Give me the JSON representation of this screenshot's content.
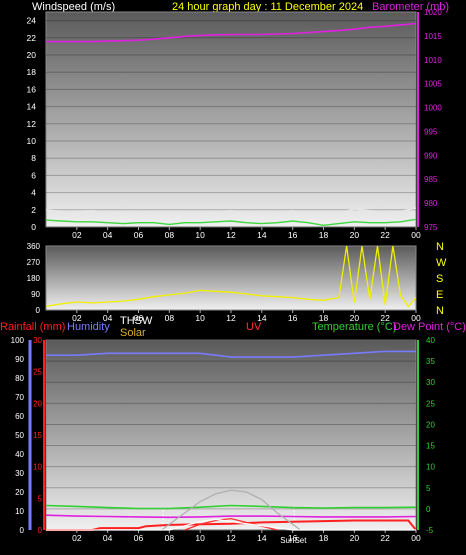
{
  "header": {
    "left_label": "Windspeed (m/s)",
    "title": "24 hour graph day : 11 December 2024",
    "right_label": "Barometer (mb)"
  },
  "lower_header": {
    "rainfall": "Rainfall (mm)",
    "humidity": "Humidity",
    "thsw": "THSW",
    "solar": "Solar",
    "uv": "UV",
    "temperature": "Temperature (°C)",
    "dew_point": "Dew Point (°C)"
  },
  "colors": {
    "background": "#000000",
    "barometer": "#e020e0",
    "wind_gust": "#e8e8e8",
    "wind_avg": "#40d840",
    "wind_dir": "#f0f000",
    "humidity": "#7a7aff",
    "temperature": "#30d030",
    "dew_point": "#e020e0",
    "rain": "#ff2020",
    "solar": "#b0b0b0",
    "uv_text": "#ff3030",
    "thsw": "#ffffff",
    "solar_label": "#d8b030"
  },
  "chart_data": [
    {
      "id": "wind-baro",
      "type": "line",
      "x_labels": [
        "02",
        "04",
        "06",
        "08",
        "10",
        "12",
        "14",
        "16",
        "18",
        "20",
        "22",
        "00"
      ],
      "left_axis": {
        "label": "Windspeed (m/s)",
        "range": [
          0,
          25
        ],
        "ticks": [
          "0",
          "2",
          "4",
          "6",
          "8",
          "10",
          "12",
          "14",
          "16",
          "18",
          "20",
          "22",
          "24"
        ]
      },
      "right_axis": {
        "label": "Barometer (mb)",
        "range": [
          975,
          1020
        ],
        "ticks": [
          "975",
          "980",
          "985",
          "990",
          "995",
          "1000",
          "1005",
          "1010",
          "1015",
          "1020"
        ]
      },
      "series": [
        {
          "name": "Barometer (mb)",
          "axis": "right",
          "x": [
            0,
            1,
            2,
            3,
            4,
            5,
            6,
            7,
            8,
            9,
            10,
            11,
            12,
            13,
            14,
            15,
            16,
            17,
            18,
            19,
            20,
            21,
            22,
            23,
            24
          ],
          "values": [
            1013.8,
            1013.8,
            1013.8,
            1013.8,
            1013.9,
            1014,
            1014.1,
            1014.3,
            1014.6,
            1014.9,
            1015.1,
            1015.2,
            1015.3,
            1015.3,
            1015.3,
            1015.4,
            1015.5,
            1015.7,
            1015.9,
            1016.1,
            1016.4,
            1016.8,
            1017.0,
            1017.3,
            1017.6
          ]
        },
        {
          "name": "Gust",
          "axis": "left",
          "x": [
            0,
            1,
            2,
            3,
            4,
            5,
            6,
            7,
            8,
            9,
            10,
            11,
            12,
            13,
            14,
            15,
            16,
            17,
            18,
            19,
            20,
            21,
            22,
            23,
            24
          ],
          "values": [
            2.0,
            1.8,
            1.8,
            1.9,
            1.7,
            1.5,
            1.8,
            1.7,
            1.3,
            1.6,
            1.5,
            1.7,
            1.9,
            1.6,
            1.4,
            1.6,
            1.9,
            1.5,
            0.8,
            1.6,
            2.1,
            1.9,
            1.7,
            1.8,
            2.2
          ]
        },
        {
          "name": "Average",
          "axis": "left",
          "x": [
            0,
            1,
            2,
            3,
            4,
            5,
            6,
            7,
            8,
            9,
            10,
            11,
            12,
            13,
            14,
            15,
            16,
            17,
            18,
            19,
            20,
            21,
            22,
            23,
            24
          ],
          "values": [
            0.8,
            0.7,
            0.6,
            0.6,
            0.5,
            0.4,
            0.5,
            0.5,
            0.3,
            0.5,
            0.5,
            0.6,
            0.7,
            0.5,
            0.4,
            0.5,
            0.7,
            0.5,
            0.2,
            0.4,
            0.6,
            0.5,
            0.5,
            0.6,
            0.9
          ]
        }
      ]
    },
    {
      "id": "wind-direction",
      "type": "line",
      "x_labels": [
        "02",
        "04",
        "06",
        "08",
        "10",
        "12",
        "14",
        "16",
        "18",
        "20",
        "22",
        "00"
      ],
      "y_ticks": [
        "0",
        "90",
        "180",
        "270",
        "360"
      ],
      "y_range": [
        0,
        360
      ],
      "dir_labels": [
        "N",
        "W",
        "S",
        "E",
        "N"
      ],
      "series": [
        {
          "name": "Wind direction",
          "x": [
            0,
            1,
            2,
            3,
            4,
            5,
            6,
            7,
            8,
            9,
            10,
            11,
            12,
            13,
            14,
            15,
            16,
            17,
            18,
            19,
            19.5,
            20,
            20.5,
            21,
            21.5,
            22,
            22.5,
            23,
            23.5,
            24
          ],
          "values": [
            20,
            35,
            45,
            40,
            45,
            50,
            60,
            75,
            85,
            95,
            110,
            105,
            100,
            90,
            80,
            75,
            70,
            60,
            55,
            70,
            360,
            40,
            360,
            60,
            360,
            30,
            360,
            80,
            20,
            70
          ]
        }
      ]
    },
    {
      "id": "temp-humidity-rain",
      "type": "line",
      "x_labels": [
        "02",
        "04",
        "06",
        "08",
        "10",
        "12",
        "14",
        "16",
        "18",
        "20",
        "22",
        "00"
      ],
      "left_outer_axis": {
        "label": "Humidity",
        "range": [
          0,
          100
        ],
        "ticks": [
          "0",
          "10",
          "20",
          "30",
          "40",
          "50",
          "60",
          "70",
          "80",
          "90",
          "100"
        ]
      },
      "left_inner_axis": {
        "label": "Rainfall (mm)",
        "range": [
          0,
          30
        ],
        "ticks": [
          "0",
          "5",
          "10",
          "15",
          "20",
          "25",
          "30"
        ]
      },
      "right_axis": {
        "label": "Temperature (°C)",
        "range": [
          -5,
          40
        ],
        "ticks": [
          "-5",
          "0",
          "5",
          "10",
          "15",
          "20",
          "25",
          "30",
          "35",
          "40"
        ]
      },
      "sunrise_sunset_label": "SunSet",
      "series": [
        {
          "name": "Humidity",
          "axis": "humidity",
          "x": [
            0,
            2,
            4,
            6,
            8,
            10,
            11,
            12,
            13,
            14,
            16,
            18,
            20,
            22,
            24
          ],
          "values": [
            92,
            92,
            93,
            93,
            93,
            93,
            92,
            91,
            91,
            91,
            91,
            92,
            93,
            94,
            94
          ]
        },
        {
          "name": "Temperature (°C)",
          "axis": "temp",
          "x": [
            0,
            2,
            4,
            6,
            8,
            10,
            12,
            14,
            16,
            18,
            20,
            22,
            24
          ],
          "values": [
            0.8,
            0.6,
            0.3,
            0.1,
            0.1,
            0.4,
            0.8,
            0.6,
            0.3,
            0.2,
            0.3,
            0.3,
            0.4
          ]
        },
        {
          "name": "Dew Point (°C)",
          "axis": "temp",
          "x": [
            0,
            2,
            4,
            6,
            8,
            10,
            12,
            14,
            16,
            18,
            20,
            22,
            24
          ],
          "values": [
            -1.5,
            -1.7,
            -1.8,
            -1.9,
            -2.0,
            -1.9,
            -1.7,
            -1.7,
            -1.8,
            -1.9,
            -1.9,
            -1.9,
            -1.8
          ]
        },
        {
          "name": "Rainfall (mm)",
          "axis": "rain",
          "x": [
            0,
            3,
            3.5,
            6,
            6.5,
            8,
            12,
            14,
            16,
            18,
            20,
            22,
            23.5,
            24
          ],
          "values": [
            0,
            0,
            0.3,
            0.3,
            0.6,
            0.8,
            1.0,
            1.2,
            1.3,
            1.4,
            1.5,
            1.5,
            1.5,
            0
          ]
        },
        {
          "name": "Solar",
          "axis": "humidity",
          "x": [
            7.5,
            8,
            9,
            10,
            11,
            12,
            13,
            14,
            15,
            16,
            16.5
          ],
          "values": [
            0,
            3,
            9,
            15,
            19,
            21,
            20,
            16,
            9,
            3,
            0
          ]
        },
        {
          "name": "UV",
          "axis": "humidity",
          "x": [
            9,
            10,
            11,
            12,
            13,
            14,
            15
          ],
          "values": [
            0,
            3,
            5,
            6,
            4,
            2,
            0
          ]
        },
        {
          "name": "THSW",
          "axis": "temp",
          "x": [
            0,
            4,
            8,
            9,
            10,
            11,
            12,
            13,
            14,
            16,
            20,
            24
          ],
          "values": [
            -5,
            -5,
            -5,
            -4,
            -3,
            -2.5,
            -3,
            -3.5,
            -4,
            -5,
            -5,
            -5
          ]
        }
      ]
    }
  ]
}
